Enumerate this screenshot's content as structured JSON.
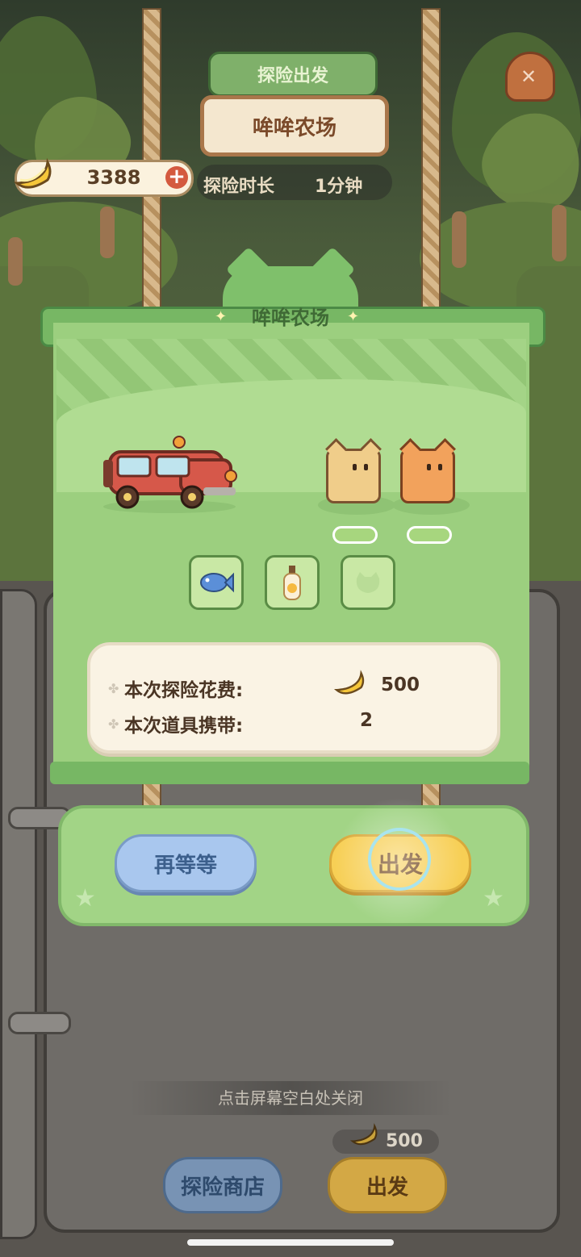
{
  "header": {
    "ribbon_title": "探险出发",
    "location_name": "哞哞农场",
    "duration_label": "探险时长",
    "duration_value": "1分钟"
  },
  "currency": {
    "banana_count": "3388",
    "icon": "banana-icon",
    "add_icon": "plus-icon"
  },
  "scroll": {
    "title": "哞哞农场",
    "vehicle": "red-jeep",
    "cats": [
      "yellow-box-cat",
      "orange-box-cat"
    ],
    "items": [
      "blue-fish-item",
      "bottle-item",
      "empty-slot"
    ]
  },
  "cost": {
    "explore_cost_label": "本次探险花费:",
    "explore_cost_value": "500",
    "items_carried_label": "本次道具携带:",
    "items_carried_value": "2"
  },
  "actions": {
    "wait_label": "再等等",
    "go_label": "出发"
  },
  "footer": {
    "close_hint": "点击屏幕空白处关闭",
    "cost_value": "500",
    "shop_label": "探险商店",
    "go_label": "出发"
  },
  "colors": {
    "scroll_green": "#9ccf7f",
    "go_yellow": "#f7cf55",
    "wait_blue": "#a9c7ee",
    "text_brown": "#4a3524"
  }
}
